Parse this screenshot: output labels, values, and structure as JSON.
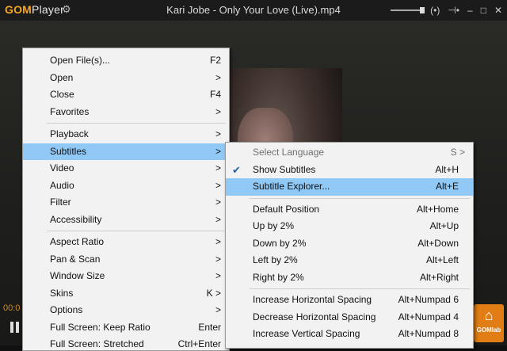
{
  "app": {
    "logo_gom": "GOM",
    "logo_player": "Player",
    "title": "Kari Jobe - Only Your Love (Live).mp4",
    "gear_icon": "gear-icon",
    "controls": {
      "audio": "(•)",
      "next": "⊣•",
      "minimize": "–",
      "maximize": "□",
      "close": "✕"
    }
  },
  "player": {
    "time": "00:0",
    "gomlab_label": "GOMlab",
    "accent": "#e07d14"
  },
  "main_menu": {
    "items": [
      {
        "label": "Open File(s)...",
        "shortcut": "F2"
      },
      {
        "label": "Open",
        "shortcut": ">"
      },
      {
        "label": "Close",
        "shortcut": "F4"
      },
      {
        "label": "Favorites",
        "shortcut": ">"
      },
      {
        "label": "Playback",
        "shortcut": ">"
      },
      {
        "label": "Subtitles",
        "shortcut": ">"
      },
      {
        "label": "Video",
        "shortcut": ">"
      },
      {
        "label": "Audio",
        "shortcut": ">"
      },
      {
        "label": "Filter",
        "shortcut": ">"
      },
      {
        "label": "Accessibility",
        "shortcut": ">"
      },
      {
        "label": "Aspect Ratio",
        "shortcut": ">"
      },
      {
        "label": "Pan & Scan",
        "shortcut": ">"
      },
      {
        "label": "Window Size",
        "shortcut": ">"
      },
      {
        "label": "Skins",
        "shortcut": "K >"
      },
      {
        "label": "Options",
        "shortcut": ">"
      },
      {
        "label": "Full Screen: Keep Ratio",
        "shortcut": "Enter"
      },
      {
        "label": "Full Screen: Stretched",
        "shortcut": "Ctrl+Enter"
      }
    ]
  },
  "subtitles_menu": {
    "items": [
      {
        "label": "Select Language",
        "shortcut": "S >"
      },
      {
        "label": "Show Subtitles",
        "shortcut": "Alt+H",
        "checked": "✔"
      },
      {
        "label": "Subtitle Explorer...",
        "shortcut": "Alt+E"
      },
      {
        "label": "Default Position",
        "shortcut": "Alt+Home"
      },
      {
        "label": "Up by 2%",
        "shortcut": "Alt+Up"
      },
      {
        "label": "Down by 2%",
        "shortcut": "Alt+Down"
      },
      {
        "label": "Left by 2%",
        "shortcut": "Alt+Left"
      },
      {
        "label": "Right by 2%",
        "shortcut": "Alt+Right"
      },
      {
        "label": "Increase Horizontal Spacing",
        "shortcut": "Alt+Numpad 6"
      },
      {
        "label": "Decrease Horizontal Spacing",
        "shortcut": "Alt+Numpad 4"
      },
      {
        "label": "Increase Vertical Spacing",
        "shortcut": "Alt+Numpad 8"
      }
    ]
  }
}
